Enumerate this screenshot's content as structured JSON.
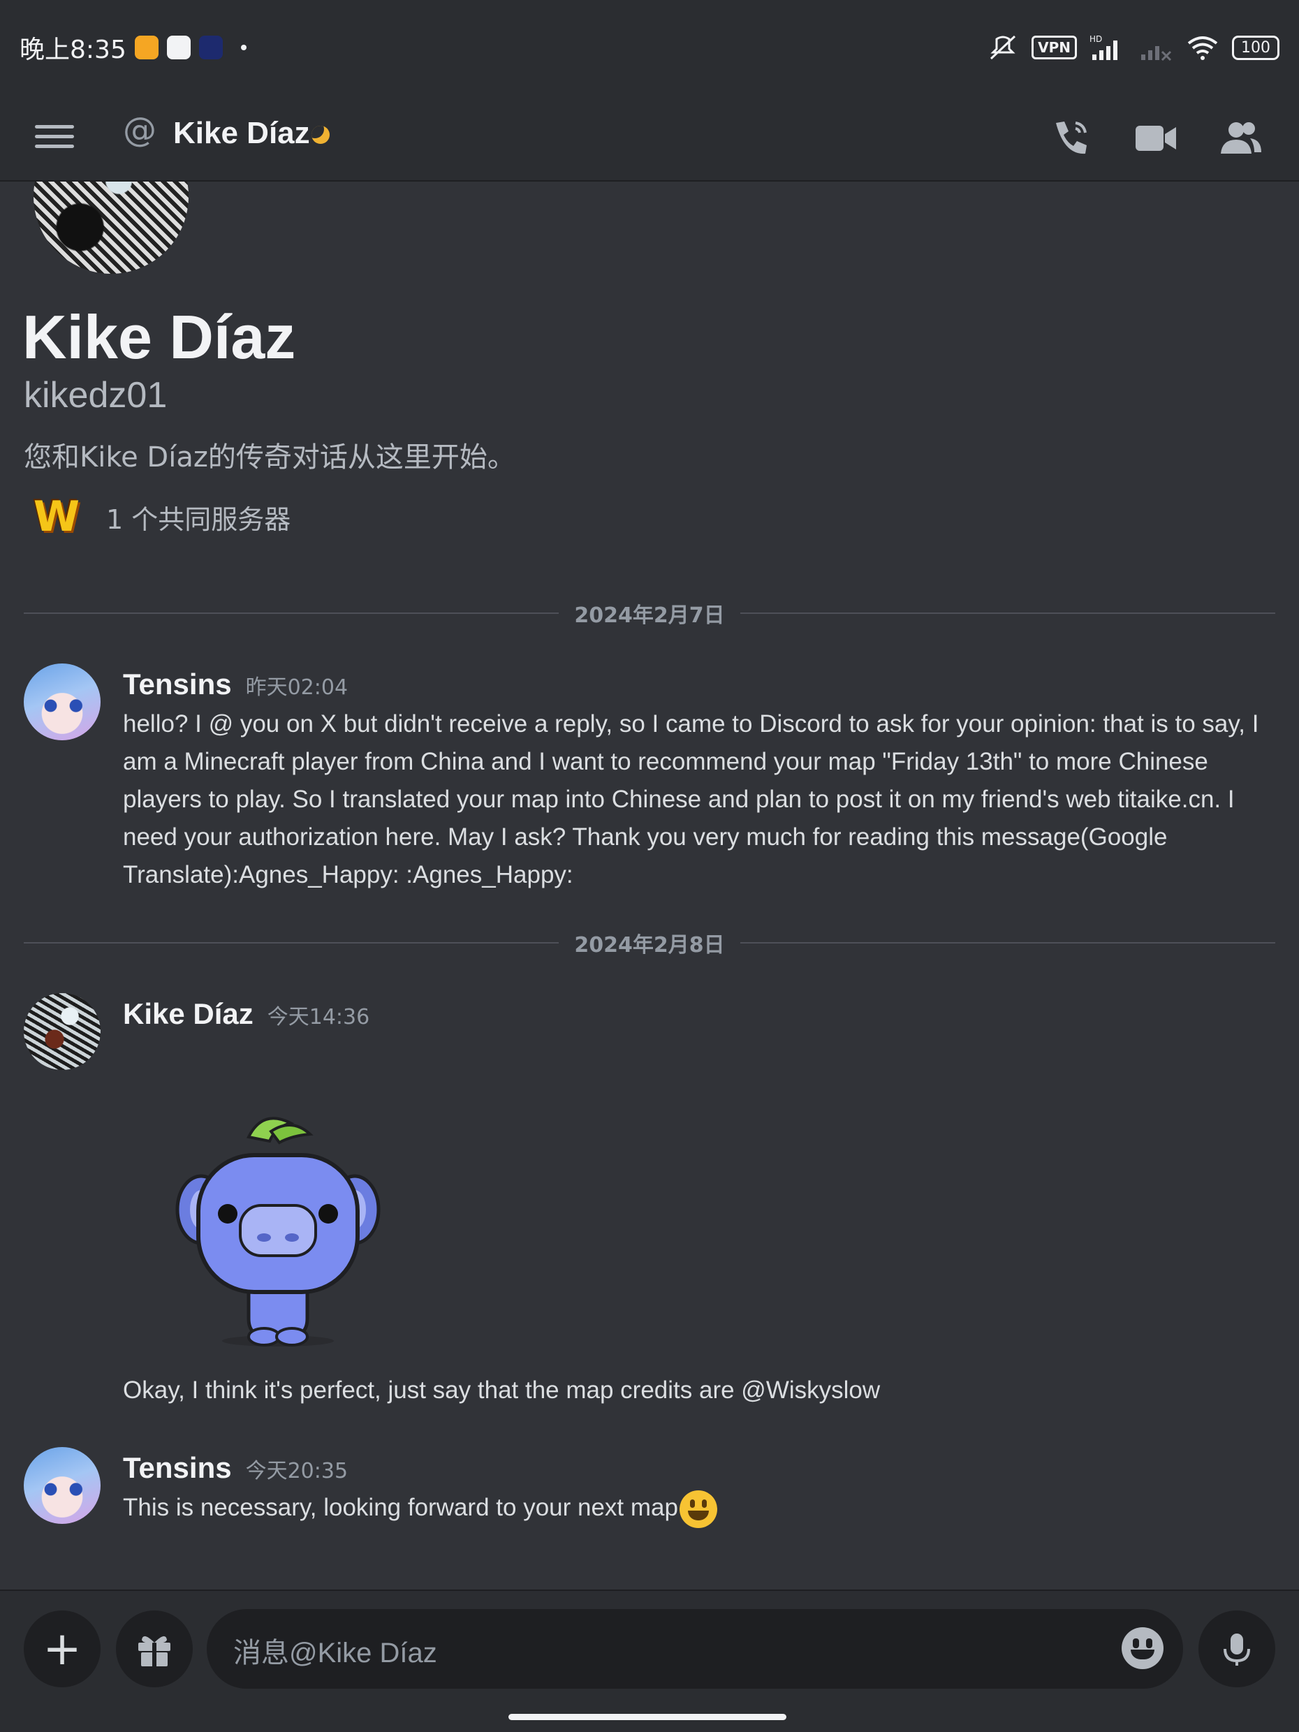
{
  "status_bar": {
    "time": "晚上8:35",
    "vpn": "VPN",
    "hd": "HD",
    "battery": "100"
  },
  "header": {
    "name": "Kike Díaz"
  },
  "profile": {
    "display_name": "Kike Díaz",
    "username": "kikedz01",
    "intro": "您和Kike Díaz的传奇对话从这里开始。",
    "mutual_servers": "1 个共同服务器",
    "server_icon_letter": "W"
  },
  "messages": {
    "date1": "2024年2月7日",
    "m1": {
      "author": "Tensins",
      "time": "昨天02:04",
      "text": "hello?  I @ you on X but didn't receive a reply, so I came to Discord to ask for your opinion: that is to say, I am a Minecraft player from China and I want to recommend your map \"Friday 13th\" to more Chinese players to play. So I translated your map into Chinese and plan to post it on my friend's web titaike.cn. I need your authorization here. May I ask? Thank you very much for reading this message(Google Translate):Agnes_Happy: :Agnes_Happy:"
    },
    "date2": "2024年2月8日",
    "m2": {
      "author": "Kike Díaz",
      "time": "今天14:36",
      "text": "Okay, I think it's perfect, just say that the map credits are @Wiskyslow"
    },
    "m3": {
      "author": "Tensins",
      "time": "今天20:35",
      "text": "This is necessary, looking forward to your next map"
    }
  },
  "composer": {
    "placeholder": "消息@Kike Díaz"
  }
}
